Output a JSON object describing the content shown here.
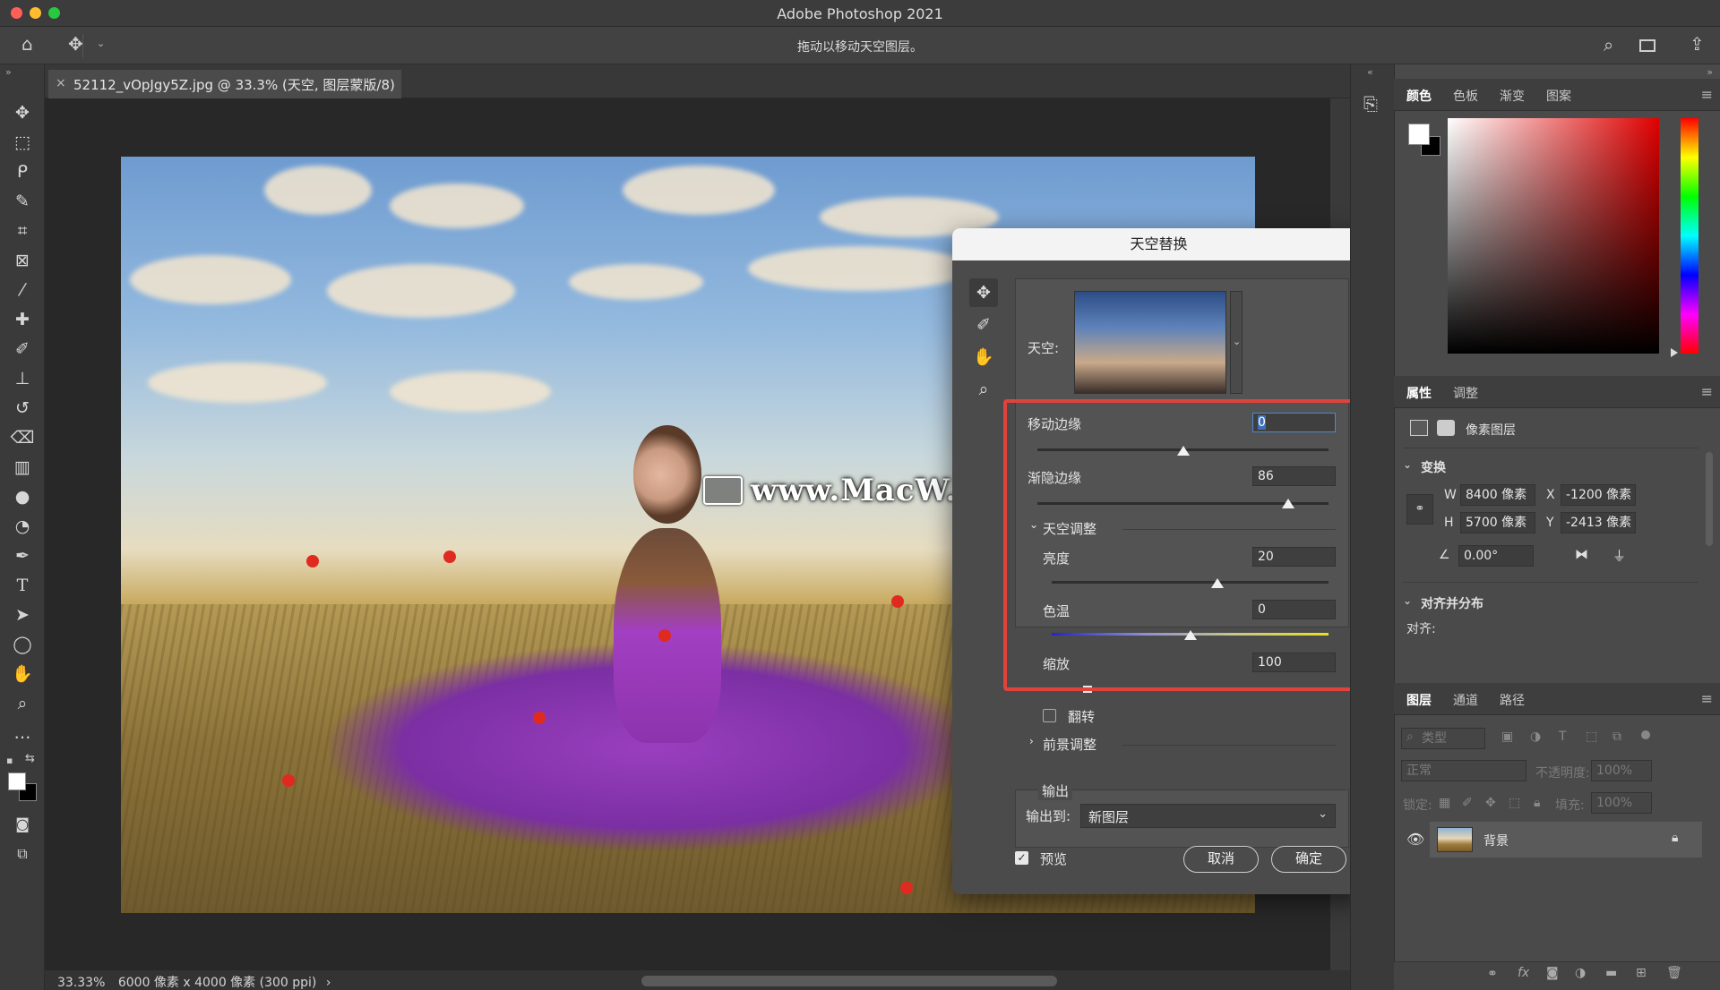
{
  "window": {
    "title": "Adobe Photoshop 2021"
  },
  "options_bar": {
    "hint": "拖动以移动天空图层。"
  },
  "document": {
    "tab_label": "52112_vOpJgy5Z.jpg @ 33.3% (天空, 图层蒙版/8)",
    "zoom": "33.33%",
    "info": "6000 像素 x 4000 像素 (300 ppi)"
  },
  "watermark": "www.MacW.com",
  "sky_dialog": {
    "title": "天空替换",
    "sky_label": "天空:",
    "shift_edge": {
      "label": "移动边缘",
      "value": "0",
      "slider": 0.5
    },
    "fade_edge": {
      "label": "渐隐边缘",
      "value": "86",
      "slider": 0.86
    },
    "sky_adjust_header": "天空调整",
    "brightness": {
      "label": "亮度",
      "value": "20",
      "slider": 0.6
    },
    "temperature": {
      "label": "色温",
      "value": "0",
      "slider": 0.5
    },
    "scale": {
      "label": "缩放",
      "value": "100"
    },
    "flip_label": "翻转",
    "flip_checked": false,
    "foreground_header": "前景调整",
    "output_header": "输出",
    "output_to_label": "输出到:",
    "output_to_value": "新图层",
    "preview_label": "预览",
    "preview_checked": true,
    "cancel_label": "取消",
    "ok_label": "确定"
  },
  "color_panel": {
    "tabs": [
      "颜色",
      "色板",
      "渐变",
      "图案"
    ],
    "active_tab": "颜色"
  },
  "properties_panel": {
    "tabs": [
      "属性",
      "调整"
    ],
    "active_tab": "属性",
    "layer_kind": "像素图层",
    "transform_header": "变换",
    "w_label": "W",
    "w_value": "8400 像素",
    "h_label": "H",
    "h_value": "5700 像素",
    "x_label": "X",
    "x_value": "-1200 像素",
    "y_label": "Y",
    "y_value": "-2413 像素",
    "angle_value": "0.00°",
    "align_header": "对齐并分布",
    "align_label": "对齐:"
  },
  "layers_panel": {
    "tabs": [
      "图层",
      "通道",
      "路径"
    ],
    "active_tab": "图层",
    "filter_placeholder": "类型",
    "blend_mode": "正常",
    "opacity_label": "不透明度:",
    "opacity_value": "100%",
    "lock_label": "锁定:",
    "fill_label": "填充:",
    "fill_value": "100%",
    "layers": [
      {
        "name": "背景",
        "visible": true,
        "locked": true
      }
    ]
  },
  "colors": {
    "highlight": "#e0433c",
    "close": "#ff5f57",
    "minimize": "#febc2e",
    "zoom": "#28c840"
  }
}
